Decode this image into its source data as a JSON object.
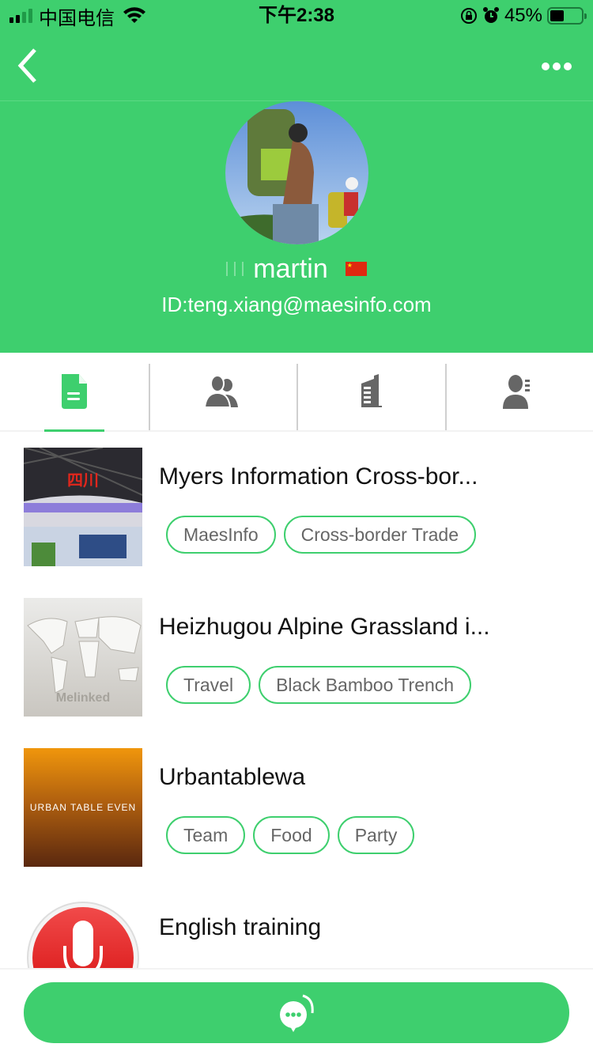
{
  "status_bar": {
    "carrier": "中国电信",
    "time": "下午2:38",
    "battery_percent": "45%",
    "battery_level": 0.45,
    "icons": [
      "signal-icon",
      "wifi-icon",
      "rotation-lock-icon",
      "alarm-icon",
      "battery-icon"
    ]
  },
  "nav": {
    "back_icon": "chevron-left-icon",
    "more_icon": "more-horizontal-icon"
  },
  "profile": {
    "name": "martin",
    "flag": "china-flag",
    "id_text": "ID:teng.xiang@maesinfo.com",
    "avatar": "hiker-with-backpack-photo"
  },
  "tabs": [
    {
      "name": "documents",
      "icon": "document-icon",
      "active": true
    },
    {
      "name": "contacts",
      "icon": "people-icon",
      "active": false
    },
    {
      "name": "company",
      "icon": "building-icon",
      "active": false
    },
    {
      "name": "profile-card",
      "icon": "user-card-icon",
      "active": false
    }
  ],
  "items": [
    {
      "title": "Myers Information Cross-bor...",
      "thumb": "exhibition-booth-photo",
      "tags": [
        "MaesInfo",
        "Cross-border Trade"
      ]
    },
    {
      "title": "Heizhugou Alpine Grassland i...",
      "thumb": "world-map-image",
      "thumb_text": "Melinked",
      "tags": [
        "Travel",
        "Black Bamboo Trench"
      ]
    },
    {
      "title": "Urbantablewa",
      "thumb": "urban-table-image",
      "thumb_text": "URBAN TABLE EVEN",
      "tags": [
        "Team",
        "Food",
        "Party"
      ]
    },
    {
      "title": "English training",
      "thumb": "microphone-app-icon",
      "tags": []
    }
  ],
  "bottom": {
    "chat_icon": "chat-bubble-icon"
  },
  "colors": {
    "brand": "#3ecf6e",
    "tab_icon": "#666666",
    "tag_text": "#666666"
  }
}
